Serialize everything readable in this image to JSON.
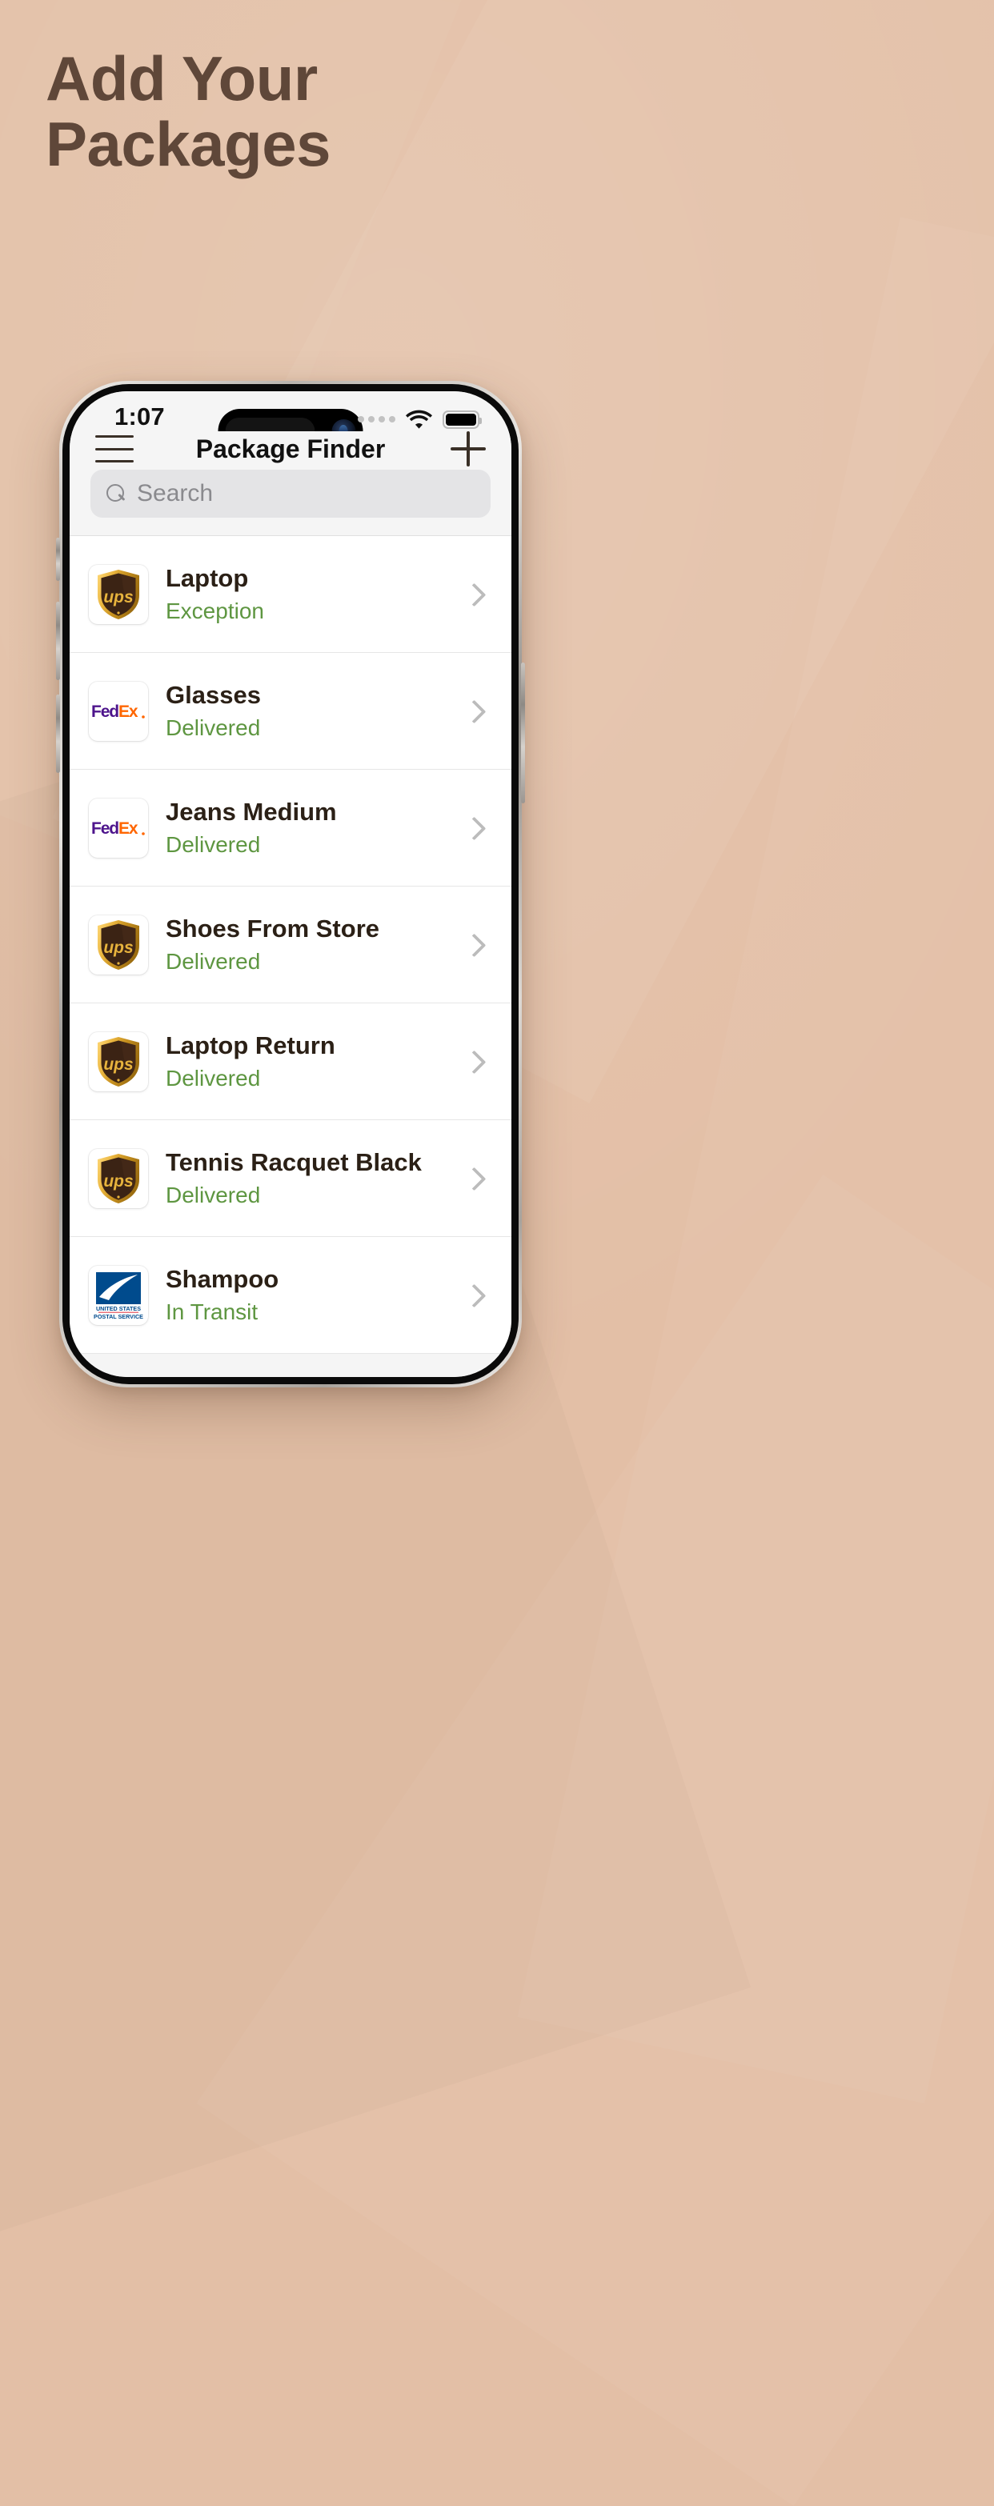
{
  "page": {
    "background_color": "#e3bfa6",
    "headline_color": "#5f4739",
    "headline_lines": [
      "Add Your",
      "Packages"
    ]
  },
  "phone": {
    "status_bar": {
      "time": "1:07",
      "signal_icon": "cellular-dots-icon",
      "wifi_icon": "wifi-icon",
      "battery_icon": "battery-full-icon",
      "dynamic_island": "dynamic-island",
      "camera_icon": "front-camera-icon"
    },
    "navbar": {
      "menu_icon": "hamburger-menu-icon",
      "title": "Package Finder",
      "add_icon": "plus-icon"
    },
    "search": {
      "icon": "search-icon",
      "placeholder": "Search",
      "value": ""
    },
    "home_indicator": "home-indicator"
  },
  "packages": {
    "status_color": "#5e9641",
    "chevron_icon": "chevron-right-icon",
    "items": [
      {
        "carrier": "UPS",
        "carrier_logo": "ups-logo",
        "name": "Laptop",
        "status": "Exception"
      },
      {
        "carrier": "FedEx",
        "carrier_logo": "fedex-logo",
        "name": "Glasses",
        "status": "Delivered"
      },
      {
        "carrier": "FedEx",
        "carrier_logo": "fedex-logo",
        "name": "Jeans Medium",
        "status": "Delivered"
      },
      {
        "carrier": "UPS",
        "carrier_logo": "ups-logo",
        "name": "Shoes From Store",
        "status": "Delivered"
      },
      {
        "carrier": "UPS",
        "carrier_logo": "ups-logo",
        "name": "Laptop Return",
        "status": "Delivered"
      },
      {
        "carrier": "UPS",
        "carrier_logo": "ups-logo",
        "name": "Tennis Racquet Black",
        "status": "Delivered"
      },
      {
        "carrier": "USPS",
        "carrier_logo": "usps-logo",
        "name": "Shampoo",
        "status": "In Transit"
      }
    ]
  }
}
